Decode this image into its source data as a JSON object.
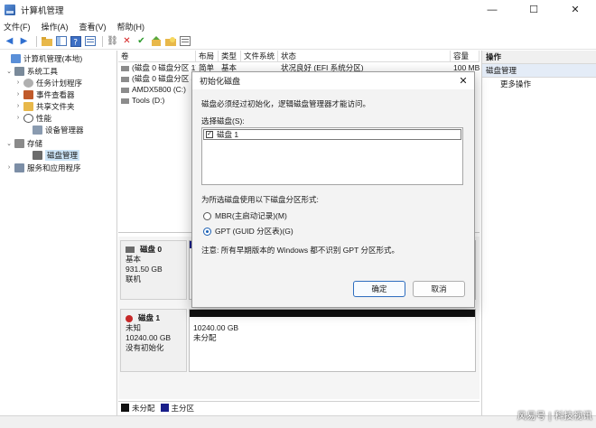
{
  "window": {
    "title": "计算机管理",
    "controls": [
      "—",
      "☐",
      "✕"
    ]
  },
  "menu": [
    "文件(F)",
    "操作(A)",
    "查看(V)",
    "帮助(H)"
  ],
  "tree": {
    "root": "计算机管理(本地)",
    "system_tools": "系统工具",
    "task_scheduler": "任务计划程序",
    "event_viewer": "事件查看器",
    "shared_folders": "共享文件夹",
    "performance": "性能",
    "device_manager": "设备管理器",
    "storage": "存储",
    "disk_management": "磁盘管理",
    "services": "服务和应用程序"
  },
  "volumes": {
    "headers": [
      "卷",
      "布局",
      "类型",
      "文件系统",
      "状态",
      "容量"
    ],
    "rows": [
      {
        "name": "(磁盘 0 磁盘分区 1)",
        "layout": "简单",
        "type": "基本",
        "fs": "",
        "status": "状况良好 (EFI 系统分区)",
        "cap": "100 MB"
      },
      {
        "name": "(磁盘 0 磁盘分区 4)",
        "layout": "",
        "type": "",
        "fs": "",
        "status": "",
        "cap": ""
      },
      {
        "name": "AMDX5800 (C:)",
        "layout": "",
        "type": "",
        "fs": "",
        "status": "",
        "cap": ""
      },
      {
        "name": "Tools (D:)",
        "layout": "",
        "type": "",
        "fs": "",
        "status": "",
        "cap": ""
      }
    ]
  },
  "disks": [
    {
      "name": "磁盘 0",
      "type": "基本",
      "size": "931.50 GB",
      "state": "联机"
    },
    {
      "name": "磁盘 1",
      "type": "未知",
      "size": "10240.00 GB",
      "state": "没有初始化",
      "part_size": "10240.00 GB",
      "part_state": "未分配"
    }
  ],
  "legend": {
    "unallocated": "未分配",
    "primary": "主分区"
  },
  "actions": {
    "header": "操作",
    "section": "磁盘管理",
    "more": "更多操作"
  },
  "dialog": {
    "title": "初始化磁盘",
    "message": "磁盘必须经过初始化，逻辑磁盘管理器才能访问。",
    "select_label": "选择磁盘(S):",
    "disk_item": "磁盘 1",
    "style_label": "为所选磁盘使用以下磁盘分区形式:",
    "mbr": "MBR(主启动记录)(M)",
    "gpt": "GPT (GUID 分区表)(G)",
    "note": "注意: 所有早期版本的 Windows 都不识别 GPT 分区形式。",
    "ok": "确定",
    "cancel": "取消"
  },
  "watermark": "风易号 | 科技视讯",
  "colors": {
    "unallocated": "#101010",
    "primary": "#1a1f8a",
    "accent": "#1a5fb4"
  }
}
